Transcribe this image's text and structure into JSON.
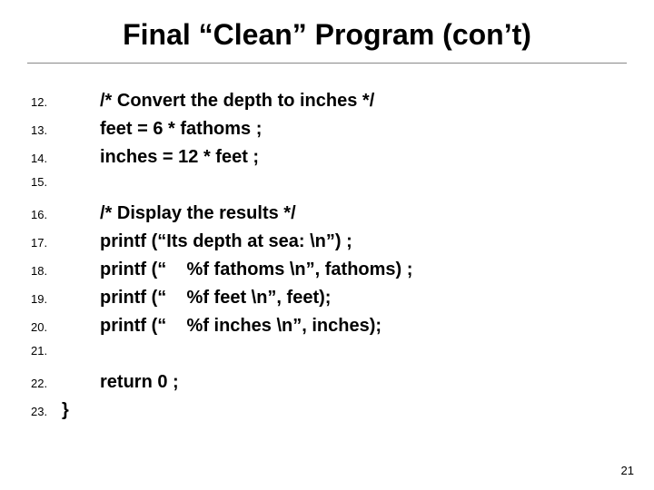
{
  "title": "Final “Clean” Program (con’t)",
  "lines": [
    {
      "n": "12.",
      "t": "/* Convert the depth to inches */",
      "indent": true
    },
    {
      "n": "13.",
      "t": "feet = 6 * fathoms ;",
      "indent": true
    },
    {
      "n": "14.",
      "t": "inches = 12 * feet ;",
      "indent": true
    },
    {
      "n": "15.",
      "t": "",
      "indent": true
    },
    {
      "n": "16.",
      "t": "/* Display the results */",
      "indent": true
    },
    {
      "n": "17.",
      "t": "printf (“Its depth at sea: \\n”) ;",
      "indent": true
    },
    {
      "n": "18.",
      "t": "printf (“    %f fathoms \\n”, fathoms) ;",
      "indent": true
    },
    {
      "n": "19.",
      "t": "printf (“    %f feet \\n”, feet);",
      "indent": true
    },
    {
      "n": "20.",
      "t": "printf (“    %f inches \\n”, inches);",
      "indent": true
    },
    {
      "n": "21.",
      "t": "",
      "indent": true
    },
    {
      "n": "22.",
      "t": "return 0 ;",
      "indent": true
    },
    {
      "n": "23.",
      "t": "}",
      "indent": false
    }
  ],
  "slide_number": "21"
}
